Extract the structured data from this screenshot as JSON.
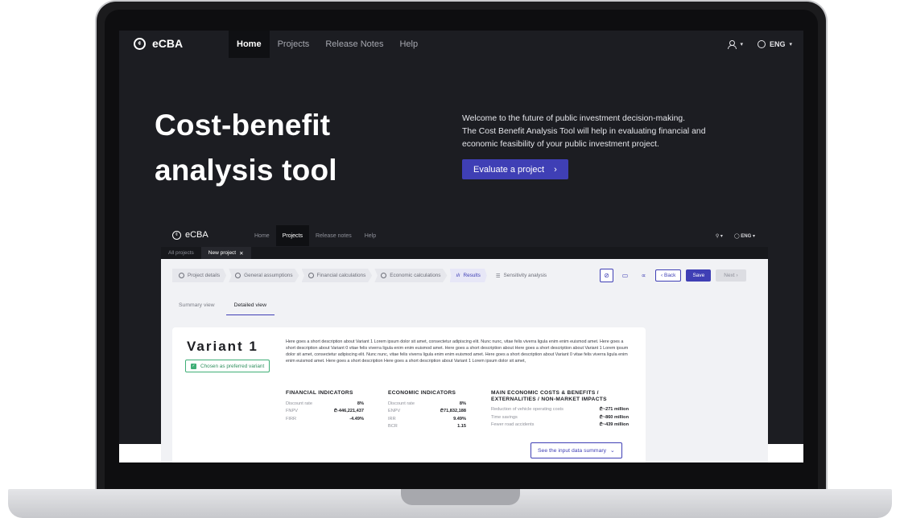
{
  "nav": {
    "logo": "eCBA",
    "logo_mark": "Ⓓ",
    "links": [
      "Home",
      "Projects",
      "Release Notes",
      "Help"
    ],
    "active": "Home",
    "language": "ENG"
  },
  "hero": {
    "title_line1": "Cost-benefit",
    "title_line2": "analysis tool",
    "text_line1": "Welcome to the future of public investment decision-making.",
    "text_line2": "The Cost Benefit Analysis Tool will help in evaluating financial and",
    "text_line3": "economic feasibility of your public investment project.",
    "cta": "Evaluate a project"
  },
  "preview": {
    "nav": {
      "logo": "eCBA",
      "links": [
        "Home",
        "Projects",
        "Release notes",
        "Help"
      ],
      "language": "ENG"
    },
    "tabs": [
      "All projects",
      "New project"
    ],
    "steps": [
      "Project details",
      "General assumptions",
      "Financial calculations",
      "Economic calculations",
      "Results",
      "Sensitivity analysis"
    ],
    "buttons": {
      "back": "Back",
      "save": "Save",
      "next": "Next"
    },
    "view_tabs": [
      "Summary view",
      "Detailed view"
    ],
    "variant": {
      "title": "Variant 1",
      "chosen": "Chosen as preferred variant",
      "description": "Here goes a short description about Variant 1 Lorem ipsum dolor sit amet, consectetur adipiscing elit. Nunc nunc, vitae felis viverra ligula enim enim euismod amet. Here goes a short description about Variant 0 vitae felis viverra ligula enim enim euismod amet. Here goes a short description about Here goes a short description about Variant 1 Lorem ipsum dolor sit amet, consectetur adipiscing elit. Nunc nunc, vitae felis viverra ligula enim enim euismod amet. Here goes a short description about Variant 0 vitae felis viverra ligula enim enim euismod amet. Here goes a short description Here goes a short description about Variant 1 Lorem ipsum dolor sit amet,"
    },
    "financial": {
      "heading": "FINANCIAL INDICATORS",
      "rows": [
        {
          "k": "Discount rate",
          "v": "8%"
        },
        {
          "k": "FNPV",
          "v": "₾-446,221,437"
        },
        {
          "k": "FIRR",
          "v": "-4.49%"
        }
      ]
    },
    "economic": {
      "heading": "ECONOMIC INDICATORS",
      "rows": [
        {
          "k": "Discount rate",
          "v": "8%"
        },
        {
          "k": "ENPV",
          "v": "₾71,832,188"
        },
        {
          "k": "IRR",
          "v": "9.49%"
        },
        {
          "k": "BCR",
          "v": "1.15"
        }
      ]
    },
    "impacts": {
      "heading_line1": "MAIN ECONOMIC COSTS & BENEFITS /",
      "heading_line2": "EXTERNALITIES / NON-MARKET IMPACTS",
      "rows": [
        {
          "k": "Reduction of vehicle operating costs",
          "v": "₾~271 million"
        },
        {
          "k": "Time savings",
          "v": "₾~860 million"
        },
        {
          "k": "Fewer road accidents",
          "v": "₾~439 million"
        }
      ]
    },
    "see_summary": "See the input data summary"
  },
  "colors": {
    "accent": "#3f3fb5",
    "dark": "#1c1d22",
    "success": "#3fae76"
  }
}
